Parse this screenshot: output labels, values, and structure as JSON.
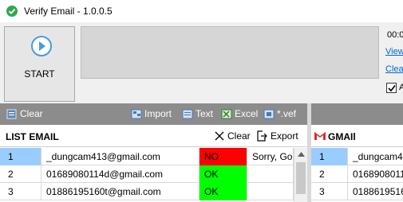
{
  "window": {
    "title": "Verify Email - 1.0.0.5"
  },
  "top_panel": {
    "start_label": "START",
    "time_text": "00:0",
    "view_link": "View",
    "clear_link": "Clea",
    "auto_label": "A",
    "auto_checked": true
  },
  "toolbar": {
    "clear_label": "Clear",
    "import_label": "Import",
    "text_label": "Text",
    "excel_label": "Excel",
    "vef_label": "*.vef"
  },
  "list_email": {
    "title": "LIST EMAIL",
    "clear_label": "Clear",
    "export_label": "Export",
    "rows": [
      {
        "num": "1",
        "email": "_dungcam413@gmail.com",
        "status": "NO",
        "message": "Sorry, Goo"
      },
      {
        "num": "2",
        "email": "01689080114d@gmail.com",
        "status": "OK",
        "message": ""
      },
      {
        "num": "3",
        "email": "01886195160t@gmail.com",
        "status": "OK",
        "message": ""
      }
    ]
  },
  "gmail_panel": {
    "title": "GMAIl",
    "rows": [
      {
        "num": "1",
        "email": "_dungcam4"
      },
      {
        "num": "2",
        "email": "0168908011"
      },
      {
        "num": "3",
        "email": "0188619516"
      }
    ]
  },
  "colors": {
    "status_no": "#ff0000",
    "status_ok": "#00ff00",
    "selected": "#99ccff",
    "link": "#0066cc",
    "toolbar": "#8c8c8c"
  }
}
